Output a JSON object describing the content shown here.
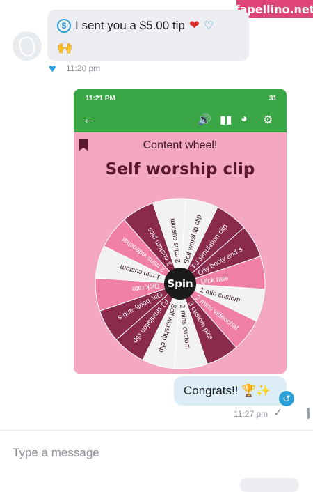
{
  "watermark": "fapellino.net",
  "incoming": {
    "text": "I sent you a $5.00 tip",
    "time": "11:20 pm"
  },
  "screenshot": {
    "status_time": "11:21 PM",
    "battery": "31",
    "subtitle": "Content wheel!",
    "title": "Self worship clip",
    "center_label": "Spin",
    "colors": {
      "header": "#3ba646",
      "background": "#f4a7c0",
      "dark": "#8a2a4c",
      "pink": "#f07fa6",
      "light": "#f2f2f2"
    },
    "segments": [
      "Self worship clip",
      "FJ simulation clip",
      "Oily booty and s",
      "Dick rate",
      "1 min custom",
      "2 mins videochat",
      "3 custom pics",
      "2 mins custom",
      "Self worship clip",
      "FJ simulation clip",
      "Oily booty and s",
      "Dick rate",
      "1 min custom",
      "2 mins videochat",
      "3 custom pics",
      "2 mins custom"
    ]
  },
  "outgoing": {
    "text": "Congrats!! 🏆✨",
    "time": "11:27 pm"
  },
  "composer": {
    "placeholder": "Type a message"
  }
}
